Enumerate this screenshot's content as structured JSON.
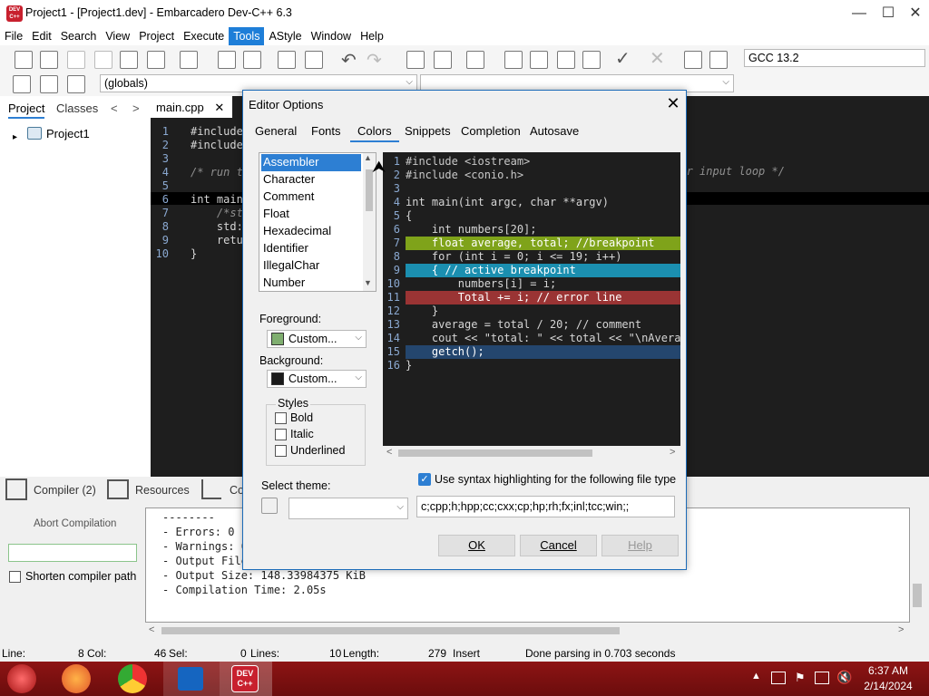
{
  "window": {
    "title": "Project1 - [Project1.dev] - Embarcadero Dev-C++ 6.3",
    "icon_text": "DEV C++",
    "minimize": "—",
    "maximize": "☐",
    "close": "✕"
  },
  "menu": [
    "File",
    "Edit",
    "Search",
    "View",
    "Project",
    "Execute",
    "Tools",
    "AStyle",
    "Window",
    "Help"
  ],
  "menu_active": "Tools",
  "compiler_combo": "GCC 13.2",
  "globals_combo": "(globals)",
  "left_tabs": {
    "project": "Project",
    "classes": "Classes",
    "prev": "<",
    "next": ">"
  },
  "project_tree": {
    "item": "Project1"
  },
  "file_tab": {
    "name": "main.cpp",
    "close": "✕"
  },
  "editor": {
    "lines": [
      {
        "n": "1",
        "text": "#include"
      },
      {
        "n": "2",
        "text": "#include"
      },
      {
        "n": "3",
        "text": ""
      },
      {
        "n": "4",
        "text": "/* run t"
      },
      {
        "n": "5",
        "text": ""
      },
      {
        "n": "6",
        "text": "int main"
      },
      {
        "n": "7",
        "text": "    /*st"
      },
      {
        "n": "8",
        "text": "    std:"
      },
      {
        "n": "9",
        "text": "    retu"
      },
      {
        "n": "10",
        "text": "}"
      }
    ],
    "right_fragment": "use\") or input loop */"
  },
  "bottom_tabs": {
    "compiler": "Compiler (2)",
    "resources": "Resources",
    "compile_log": "Co"
  },
  "bottom_left": {
    "abort": "Abort Compilation",
    "shorten": "Shorten compiler path"
  },
  "log_lines": [
    "--------",
    "- Errors: 0",
    "- Warnings: 0",
    "- Output File",
    "- Output Size: 148.33984375 KiB",
    "- Compilation Time: 2.05s"
  ],
  "status": {
    "line_label": "Line:",
    "line": "8",
    "col_label": "Col:",
    "col": "46",
    "sel_label": "Sel:",
    "sel": "0",
    "lines_label": "Lines:",
    "lines": "10",
    "length_label": "Length:",
    "length": "279",
    "mode": "Insert",
    "message": "Done parsing in 0.703 seconds"
  },
  "taskbar": {
    "time": "6:37 AM",
    "date": "2/14/2024",
    "devcpp": "DEV C++"
  },
  "dialog": {
    "title": "Editor Options",
    "close": "✕",
    "tabs": [
      "General",
      "Fonts",
      "Colors",
      "Snippets",
      "Completion",
      "Autosave"
    ],
    "active_tab": "Colors",
    "elements": [
      "Assembler",
      "Character",
      "Comment",
      "Float",
      "Hexadecimal",
      "Identifier",
      "IllegalChar",
      "Number"
    ],
    "selected_element": "Assembler",
    "foreground_label": "Foreground:",
    "foreground_value": "Custom...",
    "foreground_color": "#7fae6f",
    "background_label": "Background:",
    "background_value": "Custom...",
    "background_color": "#1a1a1a",
    "styles_label": "Styles",
    "styles": [
      "Bold",
      "Italic",
      "Underlined"
    ],
    "theme_label": "Select theme:",
    "theme_value": "",
    "syntax_check_label": "Use syntax highlighting for the following file type",
    "file_types": "c;cpp;h;hpp;cc;cxx;cp;hp;rh;fx;inl;tcc;win;;",
    "ok": "OK",
    "cancel": "Cancel",
    "help": "Help",
    "preview": [
      {
        "n": "1",
        "text": "#include <iostream>",
        "bg": "",
        "fg": "#c8c8c8"
      },
      {
        "n": "2",
        "text": "#include <conio.h>",
        "bg": "",
        "fg": "#c8c8c8"
      },
      {
        "n": "3",
        "text": "",
        "bg": "",
        "fg": "#c8c8c8"
      },
      {
        "n": "4",
        "text": "int main(int argc, char **argv)",
        "bg": "",
        "fg": "#d6d6d6"
      },
      {
        "n": "5",
        "text": "{",
        "bg": "",
        "fg": "#d6d6d6"
      },
      {
        "n": "6",
        "text": "    int numbers[20];",
        "bg": "",
        "fg": "#d6d6d6"
      },
      {
        "n": "7",
        "text": "    float average, total; //breakpoint",
        "bg": "#7fa31a",
        "fg": "#ffffff"
      },
      {
        "n": "8",
        "text": "    for (int i = 0; i <= 19; i++)",
        "bg": "",
        "fg": "#d6d6d6"
      },
      {
        "n": "9",
        "text": "    { // active breakpoint",
        "bg": "#1b8fb0",
        "fg": "#ffffff"
      },
      {
        "n": "10",
        "text": "        numbers[i] = i;",
        "bg": "",
        "fg": "#d6d6d6"
      },
      {
        "n": "11",
        "text": "        Total += i; // error line",
        "bg": "#9a3434",
        "fg": "#ffffff"
      },
      {
        "n": "12",
        "text": "    }",
        "bg": "",
        "fg": "#d6d6d6"
      },
      {
        "n": "13",
        "text": "    average = total / 20; // comment",
        "bg": "",
        "fg": "#d6d6d6"
      },
      {
        "n": "14",
        "text": "    cout << \"total: \" << total << \"\\nAverag",
        "bg": "",
        "fg": "#d6d6d6"
      },
      {
        "n": "15",
        "text": "    getch();",
        "bg": "#24466e",
        "fg": "#ffffff"
      },
      {
        "n": "16",
        "text": "}",
        "bg": "",
        "fg": "#d6d6d6"
      }
    ]
  }
}
